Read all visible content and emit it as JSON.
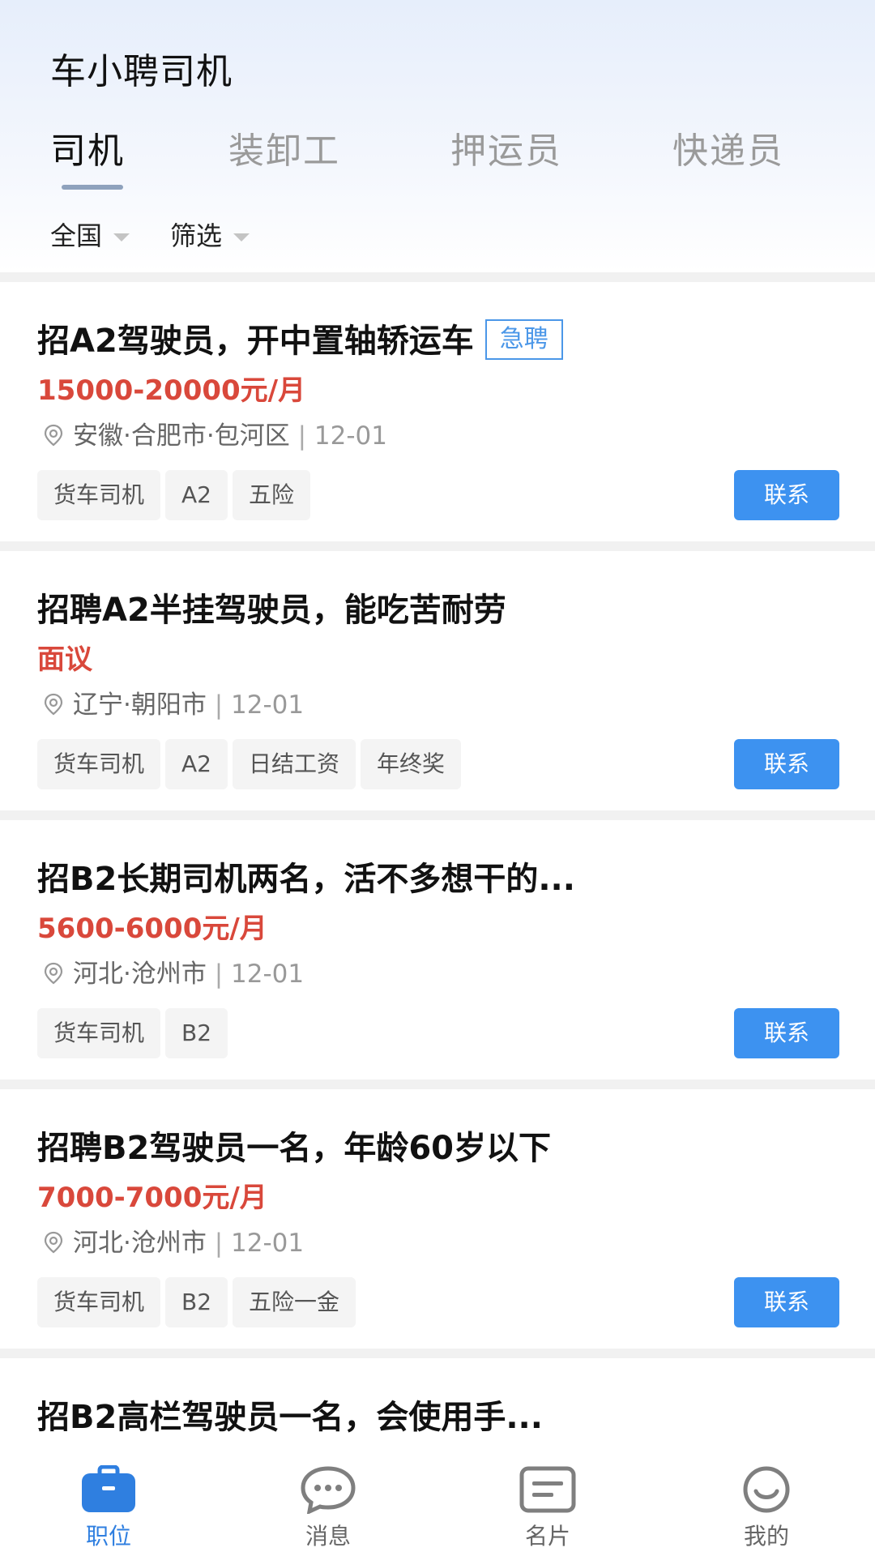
{
  "app": {
    "title": "车小聘司机"
  },
  "tabs": [
    {
      "label": "司机",
      "active": true
    },
    {
      "label": "装卸工",
      "active": false
    },
    {
      "label": "押运员",
      "active": false
    },
    {
      "label": "快递员",
      "active": false
    }
  ],
  "filters": {
    "region": "全国",
    "filter": "筛选"
  },
  "jobs": [
    {
      "title": "招A2驾驶员，开中置轴轿运车",
      "badge": "急聘",
      "salary": "15000-20000元/月",
      "location": "安徽·合肥市·包河区",
      "date": "12-01",
      "tags": [
        "货车司机",
        "A2",
        "五险"
      ],
      "contact": "联系"
    },
    {
      "title": "招聘A2半挂驾驶员，能吃苦耐劳",
      "salary": "面议",
      "location": "辽宁·朝阳市",
      "date": "12-01",
      "tags": [
        "货车司机",
        "A2",
        "日结工资",
        "年终奖"
      ],
      "contact": "联系"
    },
    {
      "title": "招B2长期司机两名，活不多想干的...",
      "salary": "5600-6000元/月",
      "location": "河北·沧州市",
      "date": "12-01",
      "tags": [
        "货车司机",
        "B2"
      ],
      "contact": "联系"
    },
    {
      "title": "招聘B2驾驶员一名，年龄60岁以下",
      "salary": "7000-7000元/月",
      "location": "河北·沧州市",
      "date": "12-01",
      "tags": [
        "货车司机",
        "B2",
        "五险一金"
      ],
      "contact": "联系"
    },
    {
      "title": "招B2高栏驾驶员一名，会使用手..."
    }
  ],
  "nav": [
    {
      "label": "职位",
      "icon": "briefcase-icon",
      "active": true
    },
    {
      "label": "消息",
      "icon": "chat-icon",
      "active": false
    },
    {
      "label": "名片",
      "icon": "card-icon",
      "active": false
    },
    {
      "label": "我的",
      "icon": "smile-icon",
      "active": false
    }
  ],
  "colors": {
    "accent": "#3d92f0",
    "salary": "#d9483b",
    "badge": "#4b97e8",
    "nav_active": "#2f7fe0"
  }
}
